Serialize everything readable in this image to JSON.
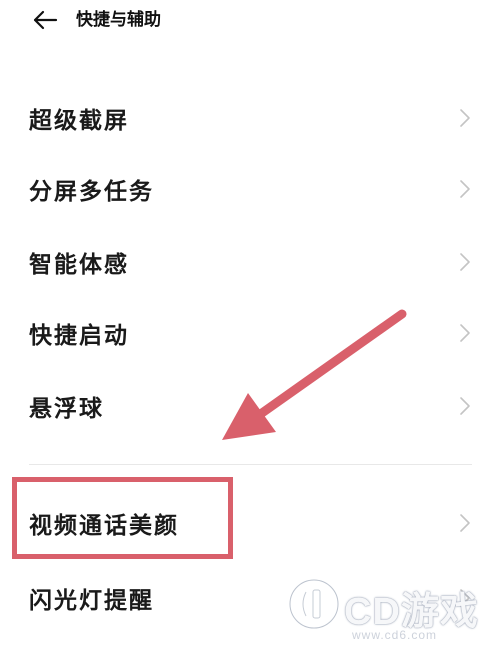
{
  "header": {
    "back_icon": "arrow-left-icon",
    "title": "快捷与辅助"
  },
  "menu": {
    "items": [
      {
        "label": "超级截屏",
        "icon": "chevron-right-icon"
      },
      {
        "label": "分屏多任务",
        "icon": "chevron-right-icon"
      },
      {
        "label": "智能体感",
        "icon": "chevron-right-icon"
      },
      {
        "label": "快捷启动",
        "icon": "chevron-right-icon"
      },
      {
        "label": "悬浮球",
        "icon": "chevron-right-icon"
      },
      {
        "label": "视频通话美颜",
        "icon": "chevron-right-icon"
      },
      {
        "label": "闪光灯提醒",
        "icon": "chevron-right-icon"
      }
    ]
  },
  "annotation": {
    "highlight_color": "#d9606b",
    "arrow_color": "#d9606b",
    "highlighted_item": "视频通话美颜"
  },
  "watermark": {
    "logo_icon": "cd-logo-icon",
    "text": "CD游戏",
    "url": "www.cd6.com"
  }
}
